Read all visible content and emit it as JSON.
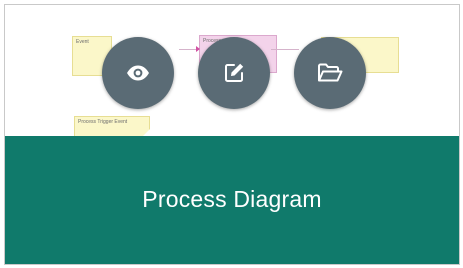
{
  "card": {
    "title": "Process Diagram"
  },
  "thumbnail": {
    "notes": [
      {
        "label": "Event"
      },
      {
        "label": "Process"
      },
      {
        "label": "Process Trigger Event"
      }
    ]
  },
  "actions": {
    "view": {
      "icon": "eye-icon"
    },
    "edit": {
      "icon": "edit-icon"
    },
    "open": {
      "icon": "folder-open-icon"
    }
  },
  "colors": {
    "banner": "#107a6b",
    "button": "#5a6b75",
    "note_yellow": "#fbf7c9",
    "note_pink": "#f3d3ea"
  }
}
